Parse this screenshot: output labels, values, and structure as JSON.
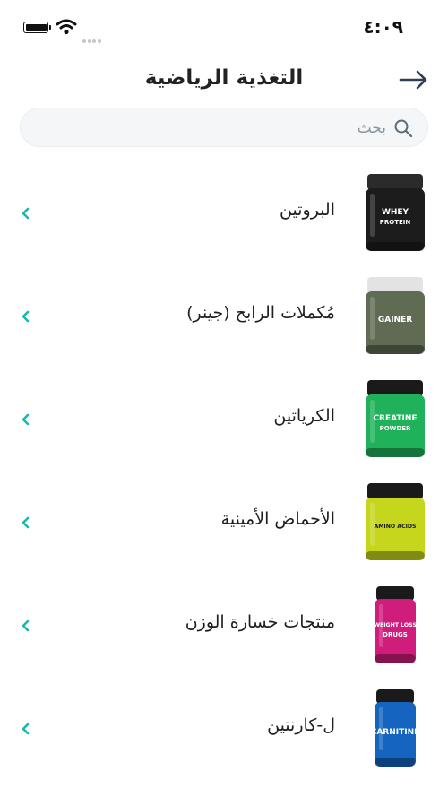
{
  "status_bar": {
    "time": "٤:٠٩"
  },
  "header": {
    "title": "التغذية الرياضية"
  },
  "search": {
    "placeholder": "بحث"
  },
  "categories": [
    {
      "label": "البروتين",
      "product_text": [
        "WHEY",
        "PROTEIN"
      ],
      "jar_color": "#1c1c1c",
      "lid_color": "#2b2b2b"
    },
    {
      "label": "مُكملات الرابح (جينر)",
      "product_text": [
        "GAINER"
      ],
      "jar_color": "#5f6b52",
      "lid_color": "#e3e3e3"
    },
    {
      "label": "الكرياتين",
      "product_text": [
        "CREATINE",
        "POWDER"
      ],
      "jar_color": "#1fb25a",
      "lid_color": "#1a1a1a"
    },
    {
      "label": "الأحماض الأمينية",
      "product_text": [
        "AMINO ACIDS"
      ],
      "jar_color": "#c5d61c",
      "lid_color": "#1a1a1a"
    },
    {
      "label": "منتجات خسارة الوزن",
      "product_text": [
        "WEIGHT LOSS",
        "DRUGS"
      ],
      "jar_color": "#d01d7c",
      "lid_color": "#1a1a1a"
    },
    {
      "label": "ل-كارنتين",
      "product_text": [
        "CARNITINE"
      ],
      "jar_color": "#1565c0",
      "lid_color": "#1a1a1a"
    }
  ],
  "colors": {
    "accent": "#16b8b0",
    "back_arrow": "#2c3e50"
  }
}
